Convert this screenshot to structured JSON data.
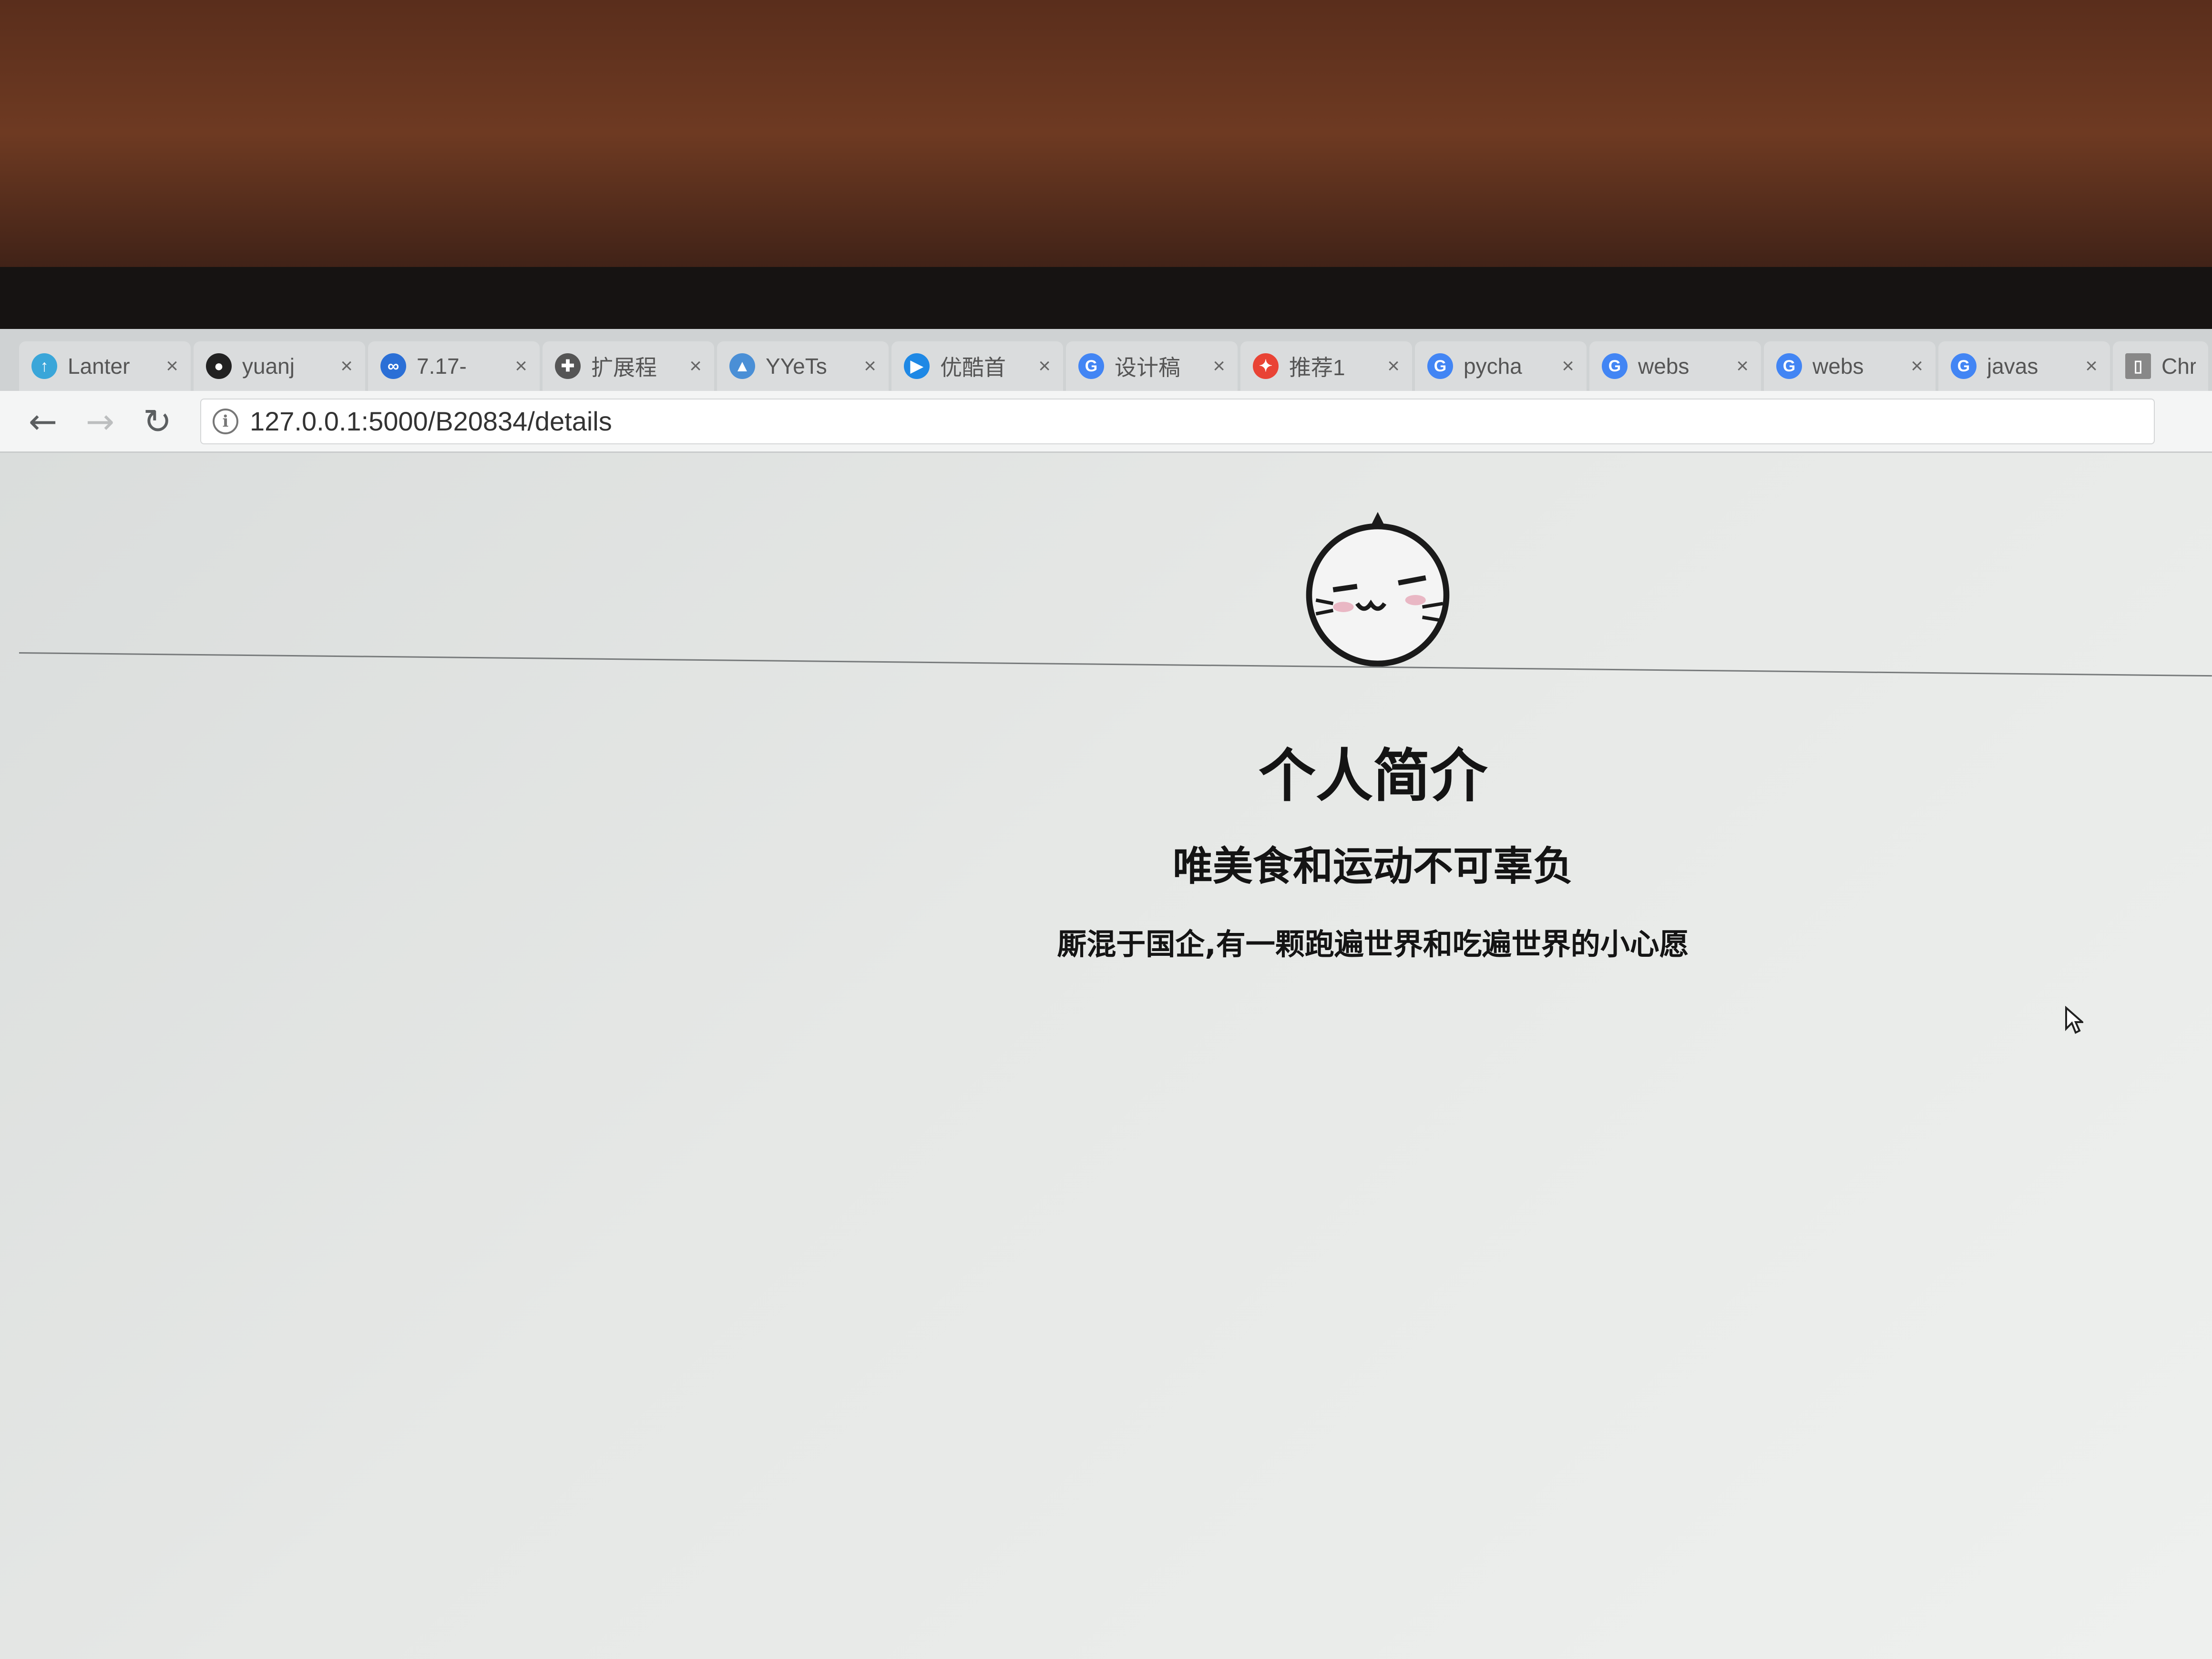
{
  "browser": {
    "tabs": [
      {
        "label": "Lanter",
        "icon": "lantern-icon",
        "color": "#3aa6d9"
      },
      {
        "label": "yuanj",
        "icon": "github-icon",
        "color": "#222222"
      },
      {
        "label": "7.17-",
        "icon": "baidu-cloud-icon",
        "color": "#2b6fd6"
      },
      {
        "label": "扩展程",
        "icon": "puzzle-icon",
        "color": "#555555"
      },
      {
        "label": "YYeTs",
        "icon": "yyets-icon",
        "color": "#4a8fd6"
      },
      {
        "label": "优酷首",
        "icon": "youku-icon",
        "color": "#1e88e5"
      },
      {
        "label": "设计稿",
        "icon": "google-icon",
        "color": "#4285f4"
      },
      {
        "label": "推荐1",
        "icon": "pinwheel-icon",
        "color": "#e94335"
      },
      {
        "label": "pycha",
        "icon": "google-icon",
        "color": "#4285f4"
      },
      {
        "label": "webs",
        "icon": "google-icon",
        "color": "#4285f4"
      },
      {
        "label": "webs",
        "icon": "google-icon",
        "color": "#4285f4"
      },
      {
        "label": "javas",
        "icon": "google-icon",
        "color": "#4285f4"
      },
      {
        "label": "Chris",
        "icon": "page-icon",
        "color": "#888888"
      }
    ],
    "url": "127.0.0.1:5000/B20834/details"
  },
  "page": {
    "title": "个人简介",
    "subtitle": "唯美食和运动不可辜负",
    "bio": "厮混于国企,有一颗跑遍世界和吃遍世界的小心愿"
  }
}
